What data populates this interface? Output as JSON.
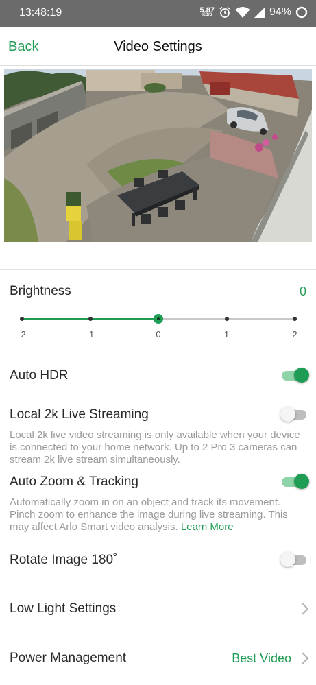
{
  "status_bar": {
    "time": "13:48:19",
    "net_speed_value": "5.87",
    "net_speed_unit": "KB/S",
    "battery_text": "94%",
    "icons": [
      "alarm-icon",
      "wifi-icon",
      "signal-icon",
      "battery-icon"
    ]
  },
  "header": {
    "back_label": "Back",
    "title": "Video Settings"
  },
  "brightness": {
    "label": "Brightness",
    "value": "0",
    "min": -2,
    "max": 2,
    "current": 0,
    "tick_labels": [
      "-2",
      "-1",
      "0",
      "1",
      "2"
    ]
  },
  "settings": {
    "auto_hdr": {
      "label": "Auto HDR",
      "enabled": true
    },
    "local_2k": {
      "label": "Local 2k Live Streaming",
      "enabled": false,
      "description": "Local 2k live video streaming is only available when your device is connected to your home network. Up to 2 Pro 3 cameras can stream 2k live stream simultaneously."
    },
    "auto_zoom": {
      "label": "Auto Zoom & Tracking",
      "enabled": true,
      "description": "Automatically zoom in on an object and track its movement. Pinch zoom to enhance the image during live streaming. This may affect Arlo Smart video analysis.",
      "learn_more": "Learn More"
    },
    "rotate_image": {
      "label": "Rotate Image 180˚",
      "enabled": false
    },
    "low_light": {
      "label": "Low Light Settings"
    },
    "power_management": {
      "label": "Power Management",
      "value": "Best Video"
    }
  },
  "colors": {
    "accent": "#1f9d55",
    "status_bar": "#6b6b6b",
    "description_text": "#9a9a9a"
  }
}
